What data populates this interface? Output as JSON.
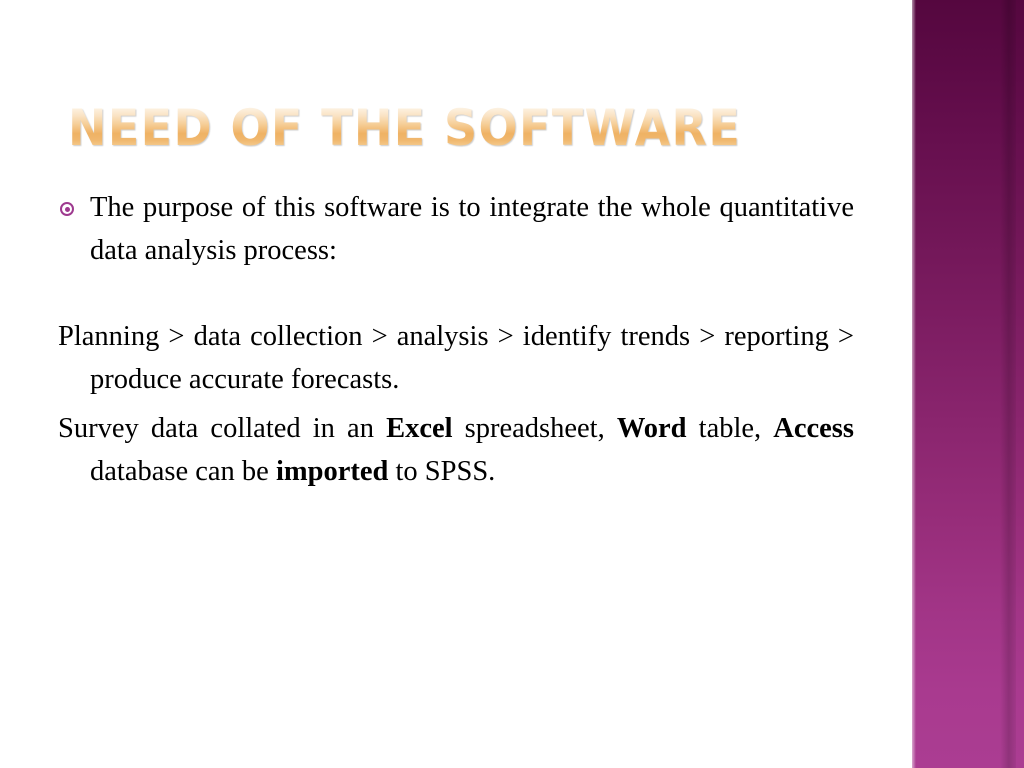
{
  "slide": {
    "title": "NEED OF THE SOFTWARE",
    "background_color": "#ffffff",
    "accent_band_color_top": "#55073f",
    "accent_band_color_bottom": "#ab3d92",
    "title_gradient_light": "#fffdf9",
    "title_gradient_deep": "#efb264",
    "bullet_color": "#9e3a8f"
  },
  "body": {
    "bullet_icon": "target-bullet",
    "paragraph1": {
      "text": "The purpose of this software is to integrate the whole quantitative data analysis process:"
    },
    "paragraph2": {
      "text": "Planning > data collection > analysis > identify trends > reporting > produce accurate forecasts."
    },
    "paragraph3": {
      "part1": "Survey data collated in an ",
      "bold1": "Excel",
      "part2": " spreadsheet, ",
      "bold2": "Word",
      "part3": " table, ",
      "bold3": "Access",
      "part4": " database can be ",
      "bold4": "imported",
      "part5": " to SPSS."
    }
  }
}
